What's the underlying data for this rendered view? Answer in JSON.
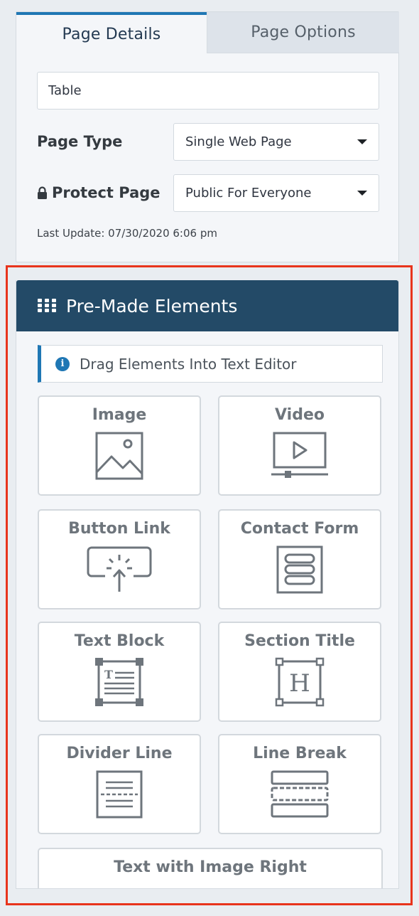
{
  "tabs": [
    {
      "label": "Page Details",
      "active": true
    },
    {
      "label": "Page Options",
      "active": false
    }
  ],
  "page_title_value": "Table",
  "page_type": {
    "label": "Page Type",
    "value": "Single Web Page"
  },
  "protect_page": {
    "label": "Protect Page",
    "value": "Public For Everyone",
    "icon": "lock-icon"
  },
  "last_update": "Last Update: 07/30/2020 6:06 pm",
  "elements_panel": {
    "title": "Pre-Made Elements",
    "hint": "Drag Elements Into Text Editor",
    "elements": [
      {
        "label": "Image",
        "icon": "image-icon"
      },
      {
        "label": "Video",
        "icon": "video-icon"
      },
      {
        "label": "Button Link",
        "icon": "button-click-icon"
      },
      {
        "label": "Contact Form",
        "icon": "form-icon"
      },
      {
        "label": "Text Block",
        "icon": "text-block-icon"
      },
      {
        "label": "Section Title",
        "icon": "heading-icon"
      },
      {
        "label": "Divider Line",
        "icon": "divider-icon"
      },
      {
        "label": "Line Break",
        "icon": "line-break-icon"
      },
      {
        "label": "Text with Image Right",
        "icon": ""
      }
    ]
  },
  "colors": {
    "header_bg": "#234a67",
    "accent": "#1f77b4",
    "highlight": "#e8341c",
    "icon_gray": "#6e757c"
  }
}
